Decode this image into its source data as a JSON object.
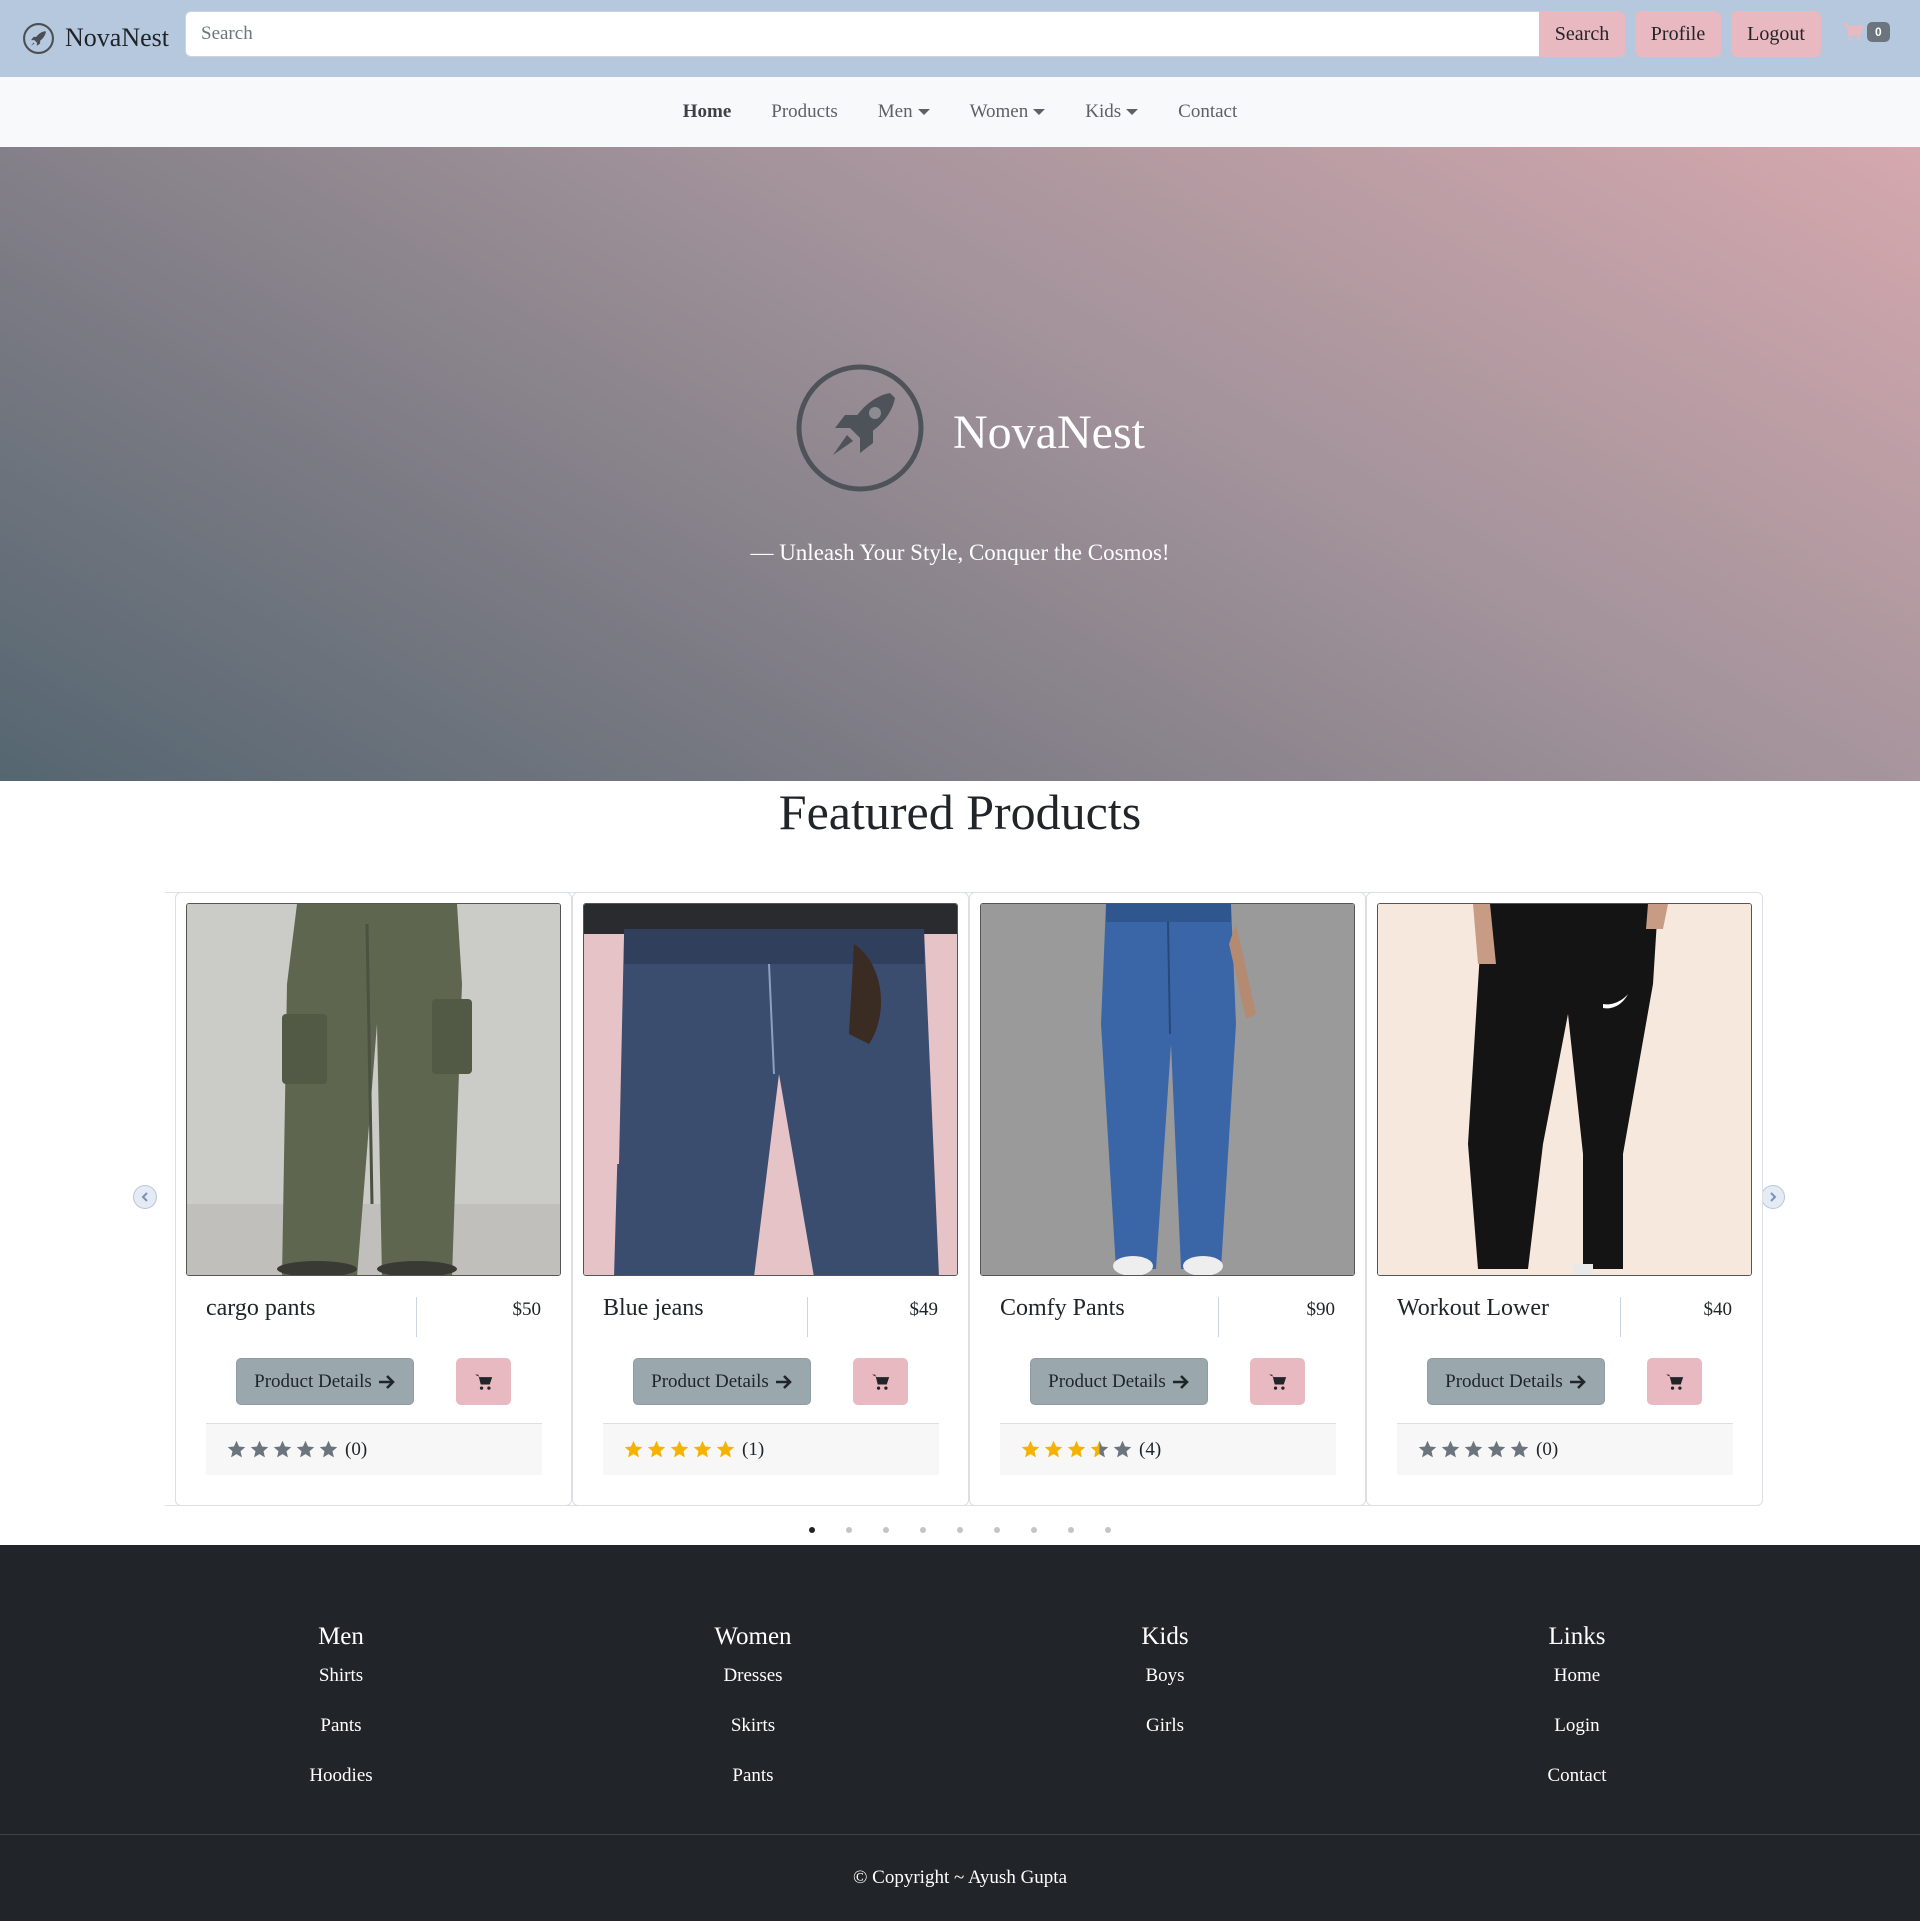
{
  "header": {
    "brand": "NovaNest",
    "search_placeholder": "Search",
    "search_button": "Search",
    "profile_button": "Profile",
    "logout_button": "Logout",
    "cart_count": "0"
  },
  "nav": {
    "items": [
      {
        "label": "Home",
        "active": true,
        "dropdown": false
      },
      {
        "label": "Products",
        "active": false,
        "dropdown": false
      },
      {
        "label": "Men",
        "active": false,
        "dropdown": true
      },
      {
        "label": "Women",
        "active": false,
        "dropdown": true
      },
      {
        "label": "Kids",
        "active": false,
        "dropdown": true
      },
      {
        "label": "Contact",
        "active": false,
        "dropdown": false
      }
    ]
  },
  "hero": {
    "title": "NovaNest",
    "tagline": "— Unleash Your Style, Conquer the Cosmos!"
  },
  "featured": {
    "title": "Featured Products",
    "details_label": "Product Details",
    "products": [
      {
        "name": "cargo pants",
        "price": "$50",
        "rating": 0,
        "rating_count": "(0)",
        "image": "olive-cargo-pants"
      },
      {
        "name": "Blue jeans",
        "price": "$49",
        "rating": 5,
        "rating_count": "(1)",
        "image": "blue-denim-jeans"
      },
      {
        "name": "Comfy Pants",
        "price": "$90",
        "rating": 3.5,
        "rating_count": "(4)",
        "image": "blue-linen-pants"
      },
      {
        "name": "Workout Lower",
        "price": "$40",
        "rating": 0,
        "rating_count": "(0)",
        "image": "black-track-pants"
      }
    ],
    "slide_count": 9,
    "active_slide": 0
  },
  "footer": {
    "columns": [
      {
        "heading": "Men",
        "links": [
          "Shirts",
          "Pants",
          "Hoodies"
        ]
      },
      {
        "heading": "Women",
        "links": [
          "Dresses",
          "Skirts",
          "Pants"
        ]
      },
      {
        "heading": "Kids",
        "links": [
          "Boys",
          "Girls"
        ]
      },
      {
        "heading": "Links",
        "links": [
          "Home",
          "Login",
          "Contact"
        ]
      }
    ],
    "copyright": "© Copyright ~ Ayush Gupta"
  },
  "colors": {
    "topbar": "#b6c8dd",
    "accent_pink": "#e8b9c0",
    "star_filled": "#f5b301",
    "star_empty": "#6c757d",
    "footer_bg": "#212529"
  }
}
